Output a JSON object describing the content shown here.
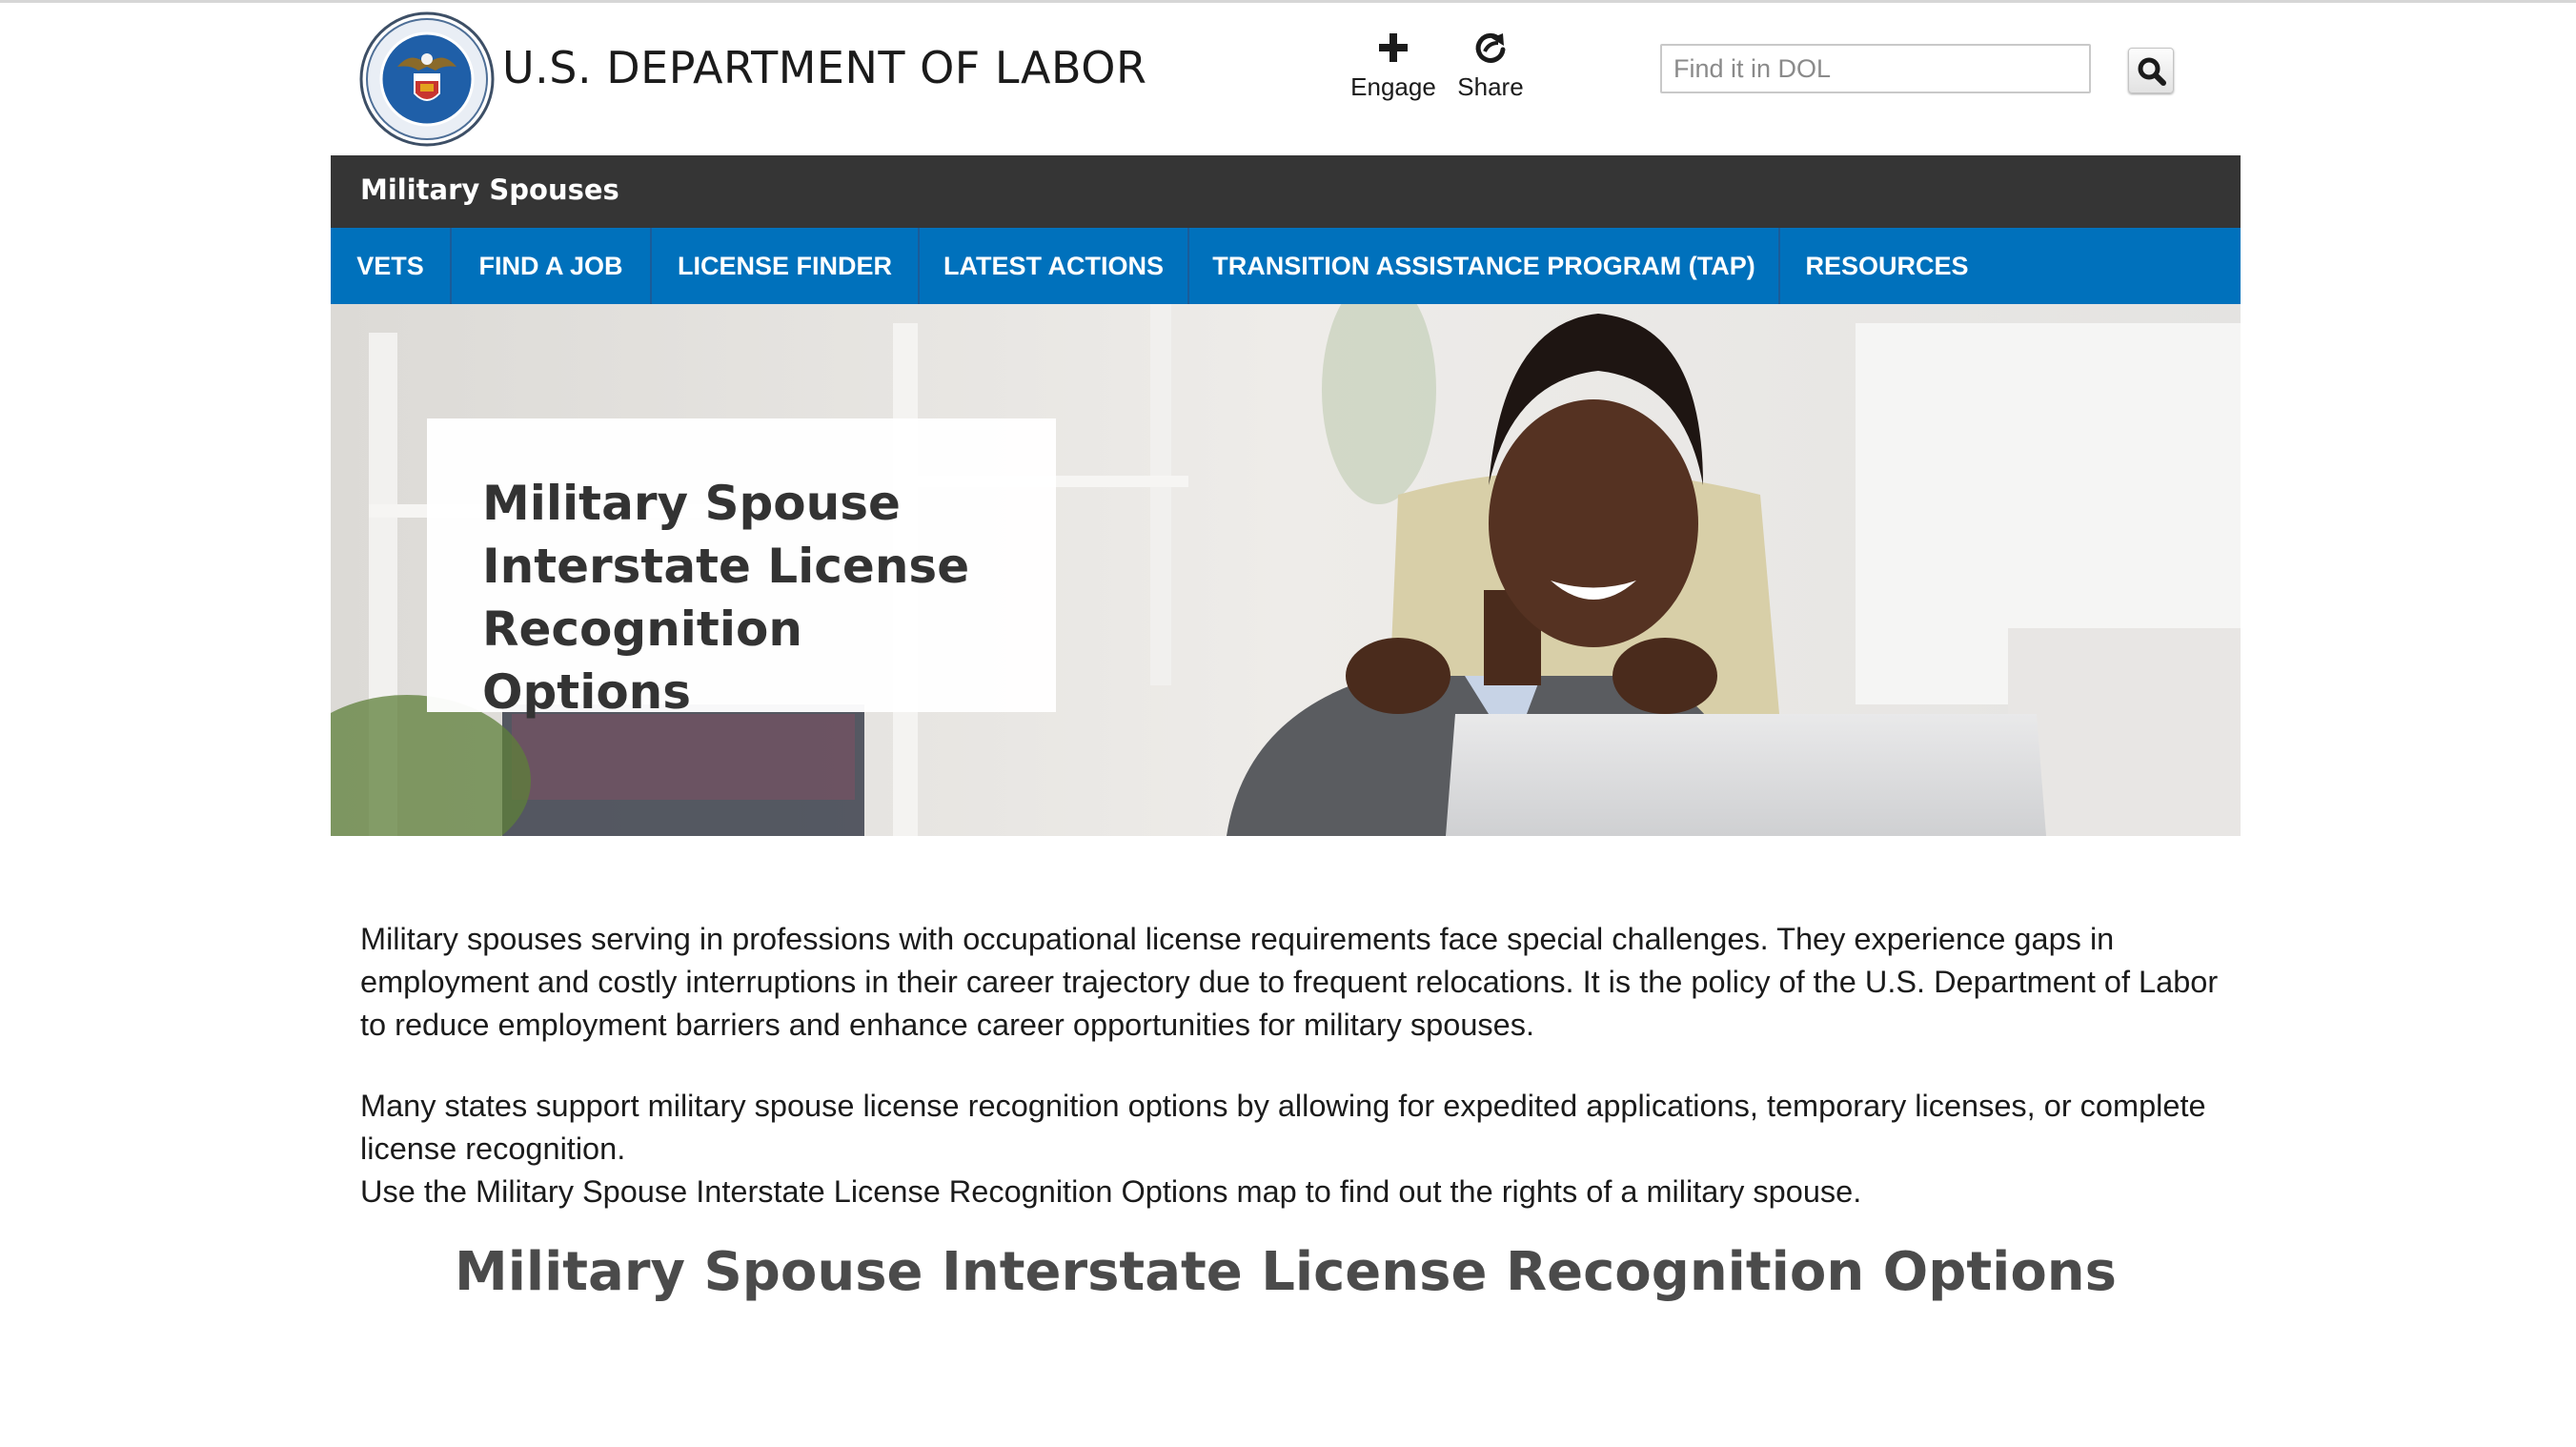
{
  "header": {
    "agency_name": "U.S. DEPARTMENT OF LABOR",
    "seal_icon": "dol-seal-logo",
    "actions": [
      {
        "label": "Engage",
        "icon": "plus-icon"
      },
      {
        "label": "Share",
        "icon": "share-icon"
      }
    ],
    "search": {
      "placeholder": "Find it in DOL",
      "value": "",
      "button_icon": "search-icon"
    }
  },
  "site_bar": {
    "title": "Military Spouses"
  },
  "nav": {
    "items": [
      {
        "label": "VETS"
      },
      {
        "label": "FIND A JOB"
      },
      {
        "label": "LICENSE FINDER"
      },
      {
        "label": "LATEST ACTIONS"
      },
      {
        "label": "TRANSITION ASSISTANCE PROGRAM (TAP)"
      },
      {
        "label": "RESOURCES"
      }
    ]
  },
  "hero": {
    "title": "Military Spouse Interstate License Recognition Options"
  },
  "content": {
    "paragraph_1": "Military spouses serving in professions with occupational license requirements face special challenges. They experience gaps in employment and costly interruptions in their career trajectory due to frequent relocations. It is the policy of the U.S. Department of Labor to reduce employment barriers and enhance career opportunities for military spouses.",
    "paragraph_2": "Many states support military spouse license recognition options by allowing for expedited applications, temporary licenses, or complete license recognition.",
    "paragraph_3": "Use the Military Spouse Interstate License Recognition Options map to find out the rights of a military spouse.",
    "map_heading": "Military Spouse Interstate License Recognition Options"
  },
  "colors": {
    "nav_blue": "#0071bc",
    "site_bar": "#353535",
    "seal_blue": "#1f5fa8",
    "heading_gray": "#4b4b4b"
  }
}
